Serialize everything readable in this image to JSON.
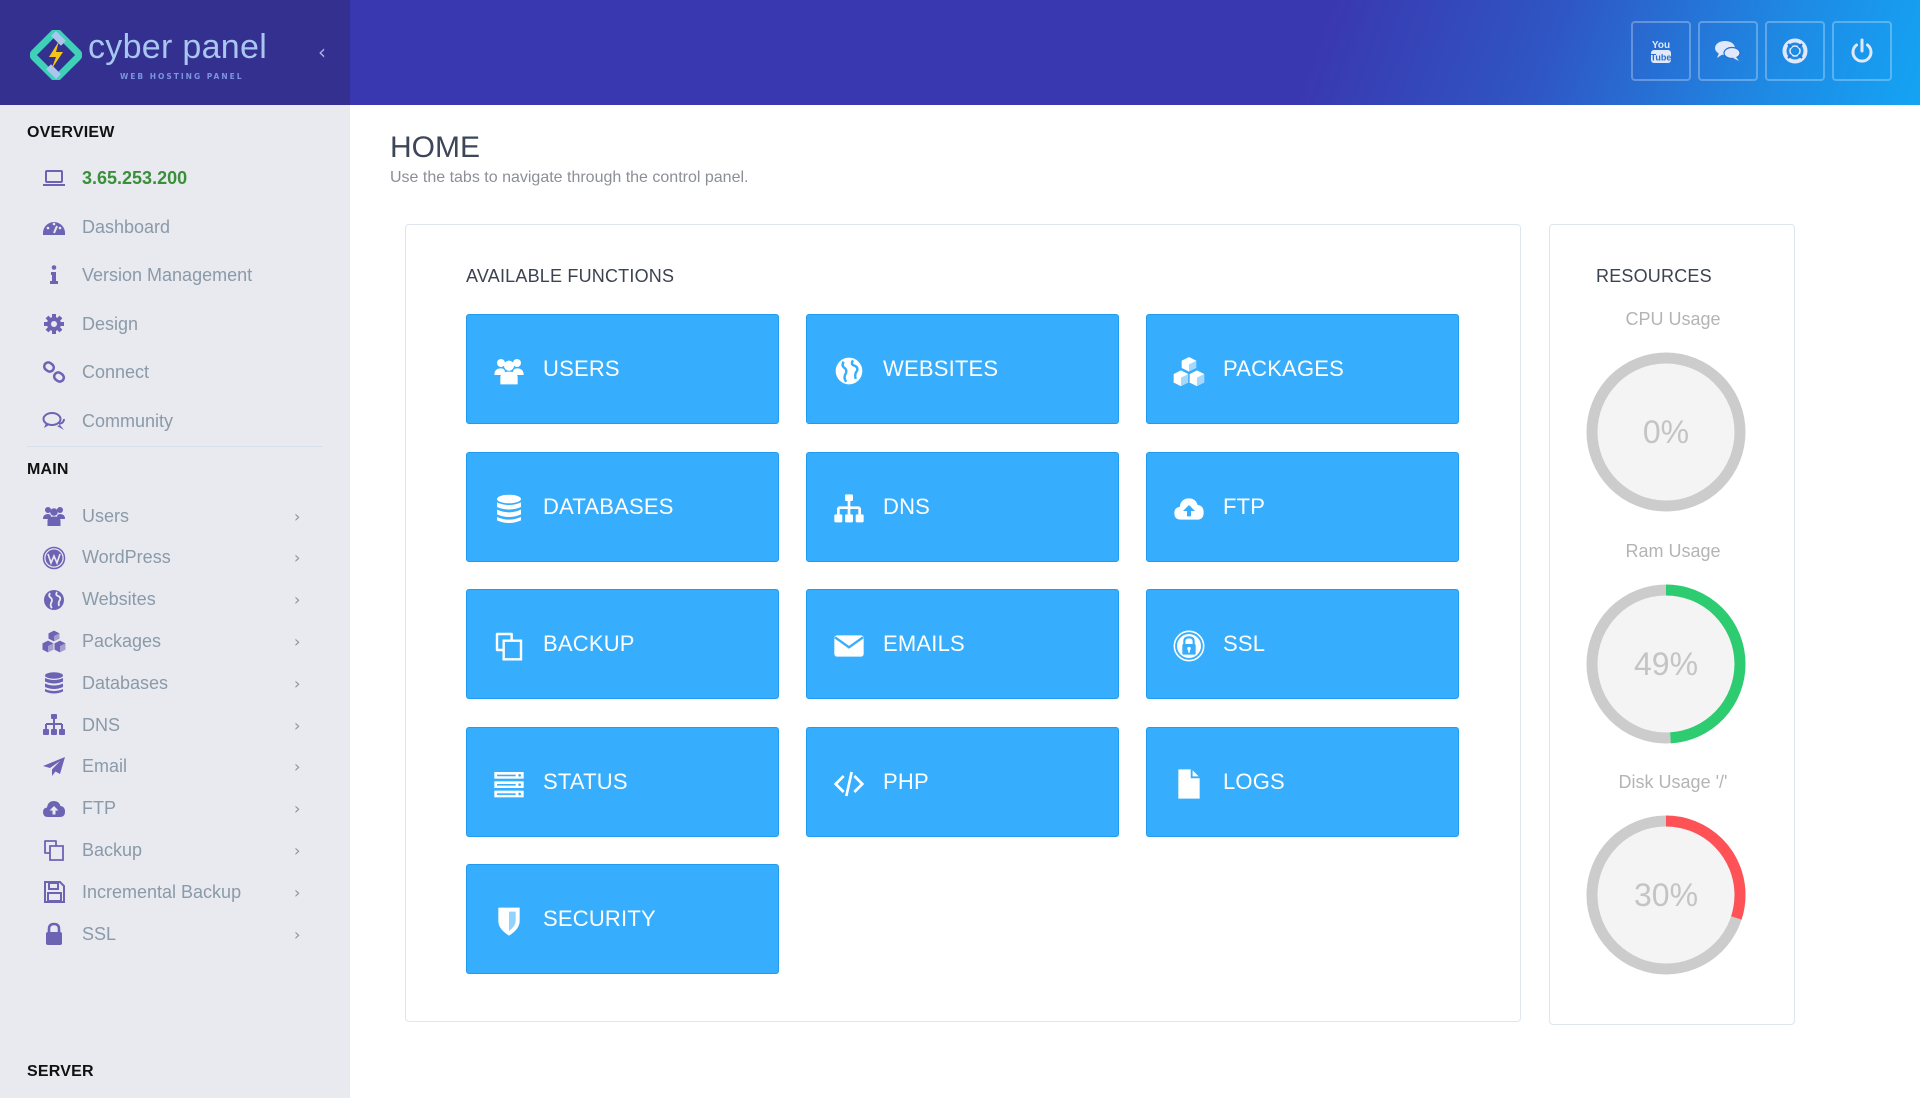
{
  "header": {
    "logo_text": "cyber panel",
    "logo_subtext": "WEB HOSTING PANEL",
    "collapse_icon": "chevron-left-icon",
    "buttons": [
      {
        "name": "youtube-button",
        "icon": "youtube-icon"
      },
      {
        "name": "community-chat-button",
        "icon": "chat-bubbles-icon"
      },
      {
        "name": "support-button",
        "icon": "life-ring-icon"
      },
      {
        "name": "logout-button",
        "icon": "power-icon"
      }
    ]
  },
  "sidebar": {
    "sections": {
      "overview": "OVERVIEW",
      "main": "MAIN",
      "server": "SERVER"
    },
    "overview_items": [
      {
        "label": "3.65.253.200",
        "icon": "laptop-icon"
      },
      {
        "label": "Dashboard",
        "icon": "dashboard-icon"
      },
      {
        "label": "Version Management",
        "icon": "info-icon"
      },
      {
        "label": "Design",
        "icon": "gear-icon"
      },
      {
        "label": "Connect",
        "icon": "link-icon"
      },
      {
        "label": "Community",
        "icon": "comments-icon"
      }
    ],
    "main_items": [
      {
        "label": "Users",
        "icon": "users-icon"
      },
      {
        "label": "WordPress",
        "icon": "wordpress-icon"
      },
      {
        "label": "Websites",
        "icon": "globe-icon"
      },
      {
        "label": "Packages",
        "icon": "cubes-icon"
      },
      {
        "label": "Databases",
        "icon": "database-icon"
      },
      {
        "label": "DNS",
        "icon": "sitemap-icon"
      },
      {
        "label": "Email",
        "icon": "paper-plane-icon"
      },
      {
        "label": "FTP",
        "icon": "cloud-upload-icon"
      },
      {
        "label": "Backup",
        "icon": "copy-icon"
      },
      {
        "label": "Incremental Backup",
        "icon": "floppy-icon"
      },
      {
        "label": "SSL",
        "icon": "lock-icon"
      }
    ],
    "chevron": "›"
  },
  "main": {
    "title": "HOME",
    "subtitle": "Use the tabs to navigate through the control panel.",
    "functions": {
      "title": "AVAILABLE FUNCTIONS",
      "tiles": [
        {
          "label": "USERS",
          "icon": "users-icon"
        },
        {
          "label": "WEBSITES",
          "icon": "globe-icon"
        },
        {
          "label": "PACKAGES",
          "icon": "cubes-icon"
        },
        {
          "label": "DATABASES",
          "icon": "database-icon"
        },
        {
          "label": "DNS",
          "icon": "sitemap-icon"
        },
        {
          "label": "FTP",
          "icon": "cloud-upload-icon"
        },
        {
          "label": "BACKUP",
          "icon": "copy-icon"
        },
        {
          "label": "EMAILS",
          "icon": "envelope-icon"
        },
        {
          "label": "SSL",
          "icon": "lock-circle-icon"
        },
        {
          "label": "STATUS",
          "icon": "server-icon"
        },
        {
          "label": "PHP",
          "icon": "code-icon"
        },
        {
          "label": "LOGS",
          "icon": "file-icon"
        },
        {
          "label": "SECURITY",
          "icon": "shield-icon"
        }
      ]
    },
    "resources": {
      "title": "RESOURCES",
      "gauges": [
        {
          "label": "CPU Usage",
          "value": 0,
          "text": "0%",
          "color": "#2ecc71"
        },
        {
          "label": "Ram Usage",
          "value": 49,
          "text": "49%",
          "color": "#2ecc71"
        },
        {
          "label": "Disk Usage '/'",
          "value": 30,
          "text": "30%",
          "color": "#ff5257"
        }
      ]
    }
  },
  "colors": {
    "header": "#3a38b0",
    "brand": "#33308f",
    "tile": "#36adfd",
    "sidebar_bg": "#e9e9f0",
    "icon": "#6c63b5",
    "ip_text": "#3a8f3a",
    "gauge_track": "#cccccc",
    "gauge_fill_bg": "#f4f4f4"
  }
}
